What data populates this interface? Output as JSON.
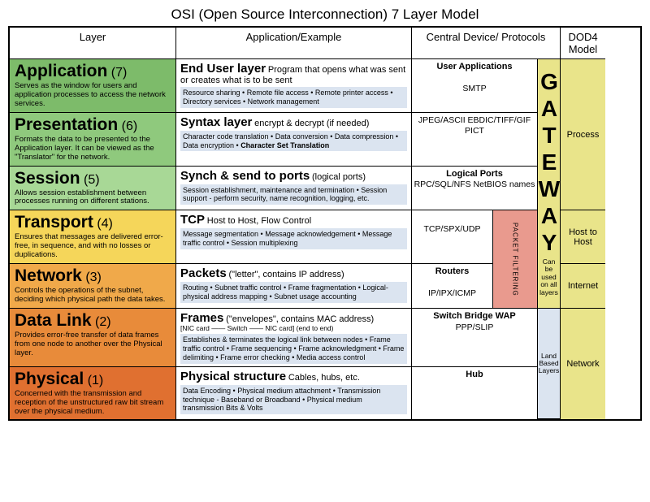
{
  "title": "OSI (Open Source Interconnection) 7 Layer Model",
  "headers": {
    "layer": "Layer",
    "app": "Application/Example",
    "dev": "Central Device/ Protocols",
    "dod": "DOD4 Model"
  },
  "layers": {
    "l7": {
      "name": "Application",
      "num": "(7)",
      "desc": "Serves as the window for users and application processes to access the network services."
    },
    "l6": {
      "name": "Presentation",
      "num": "(6)",
      "desc": "Formats the data to be presented to the Application layer. It can be viewed as the \"Translator\" for the network."
    },
    "l5": {
      "name": "Session",
      "num": "(5)",
      "desc": "Allows session establishment between processes running on different stations."
    },
    "l4": {
      "name": "Transport",
      "num": "(4)",
      "desc": "Ensures that messages are delivered error-free, in sequence, and with no losses or duplications."
    },
    "l3": {
      "name": "Network",
      "num": "(3)",
      "desc": "Controls the operations of the subnet, deciding which physical path the data takes."
    },
    "l2": {
      "name": "Data Link",
      "num": "(2)",
      "desc": "Provides error-free transfer of data frames from one node to another over the Physical layer."
    },
    "l1": {
      "name": "Physical",
      "num": "(1)",
      "desc": "Concerned with the transmission and reception of the unstructured raw bit stream over the physical medium."
    }
  },
  "apps": {
    "l7": {
      "title": "End User layer",
      "sub": "Program that opens what was sent or creates what is to be sent",
      "detail": "Resource sharing • Remote file access • Remote printer access • Directory services • Network management"
    },
    "l6": {
      "title": "Syntax layer",
      "sub": "encrypt & decrypt (if needed)",
      "detail": "Character code translation • Data conversion • Data compression • Data encryption • Character Set Translation"
    },
    "l5": {
      "title": "Synch & send to ports",
      "sub": "(logical ports)",
      "detail": "Session establishment, maintenance and termination • Session support - perform security, name recognition, logging, etc."
    },
    "l4": {
      "title": "TCP",
      "sub": "Host to Host, Flow Control",
      "detail": "Message segmentation • Message acknowledgement • Message traffic control • Session multiplexing"
    },
    "l3": {
      "title": "Packets",
      "sub": "(\"letter\", contains IP address)",
      "detail": "Routing • Subnet traffic control • Frame fragmentation • Logical-physical address mapping • Subnet usage accounting"
    },
    "l2": {
      "title": "Frames",
      "sub": "(\"envelopes\", contains MAC address)",
      "subline": "[NIC card —— Switch —— NIC card]            (end to end)",
      "detail": "Establishes & terminates the logical link between nodes • Frame traffic control • Frame sequencing • Frame acknowledgment • Frame delimiting • Frame error checking • Media access control"
    },
    "l1": {
      "title": "Physical structure",
      "sub": "Cables, hubs, etc.",
      "detail": "Data Encoding • Physical medium attachment • Transmission technique - Baseband or Broadband • Physical medium transmission Bits & Volts"
    }
  },
  "devs": {
    "l7": {
      "bold": "User Applications",
      "plain": "SMTP"
    },
    "l6": {
      "plain": "JPEG/ASCII EBDIC/TIFF/GIF PICT"
    },
    "l5": {
      "bold": "Logical Ports",
      "plain": "RPC/SQL/NFS NetBIOS names"
    },
    "l4": {
      "plain": "TCP/SPX/UDP"
    },
    "l3": {
      "bold": "Routers",
      "plain": "IP/IPX/ICMP"
    },
    "l2": {
      "bold": "Switch Bridge WAP",
      "plain": "PPP/SLIP"
    },
    "l1": {
      "bold": "Hub"
    }
  },
  "side": {
    "packet_filtering": "PACKET  FILTERING",
    "gateway": "GATEWAY",
    "gateway_note": "Can be used on all layers",
    "land_based": "Land Based Layers"
  },
  "dod": {
    "process": "Process",
    "host": "Host to Host",
    "internet": "Internet",
    "network": "Network"
  }
}
